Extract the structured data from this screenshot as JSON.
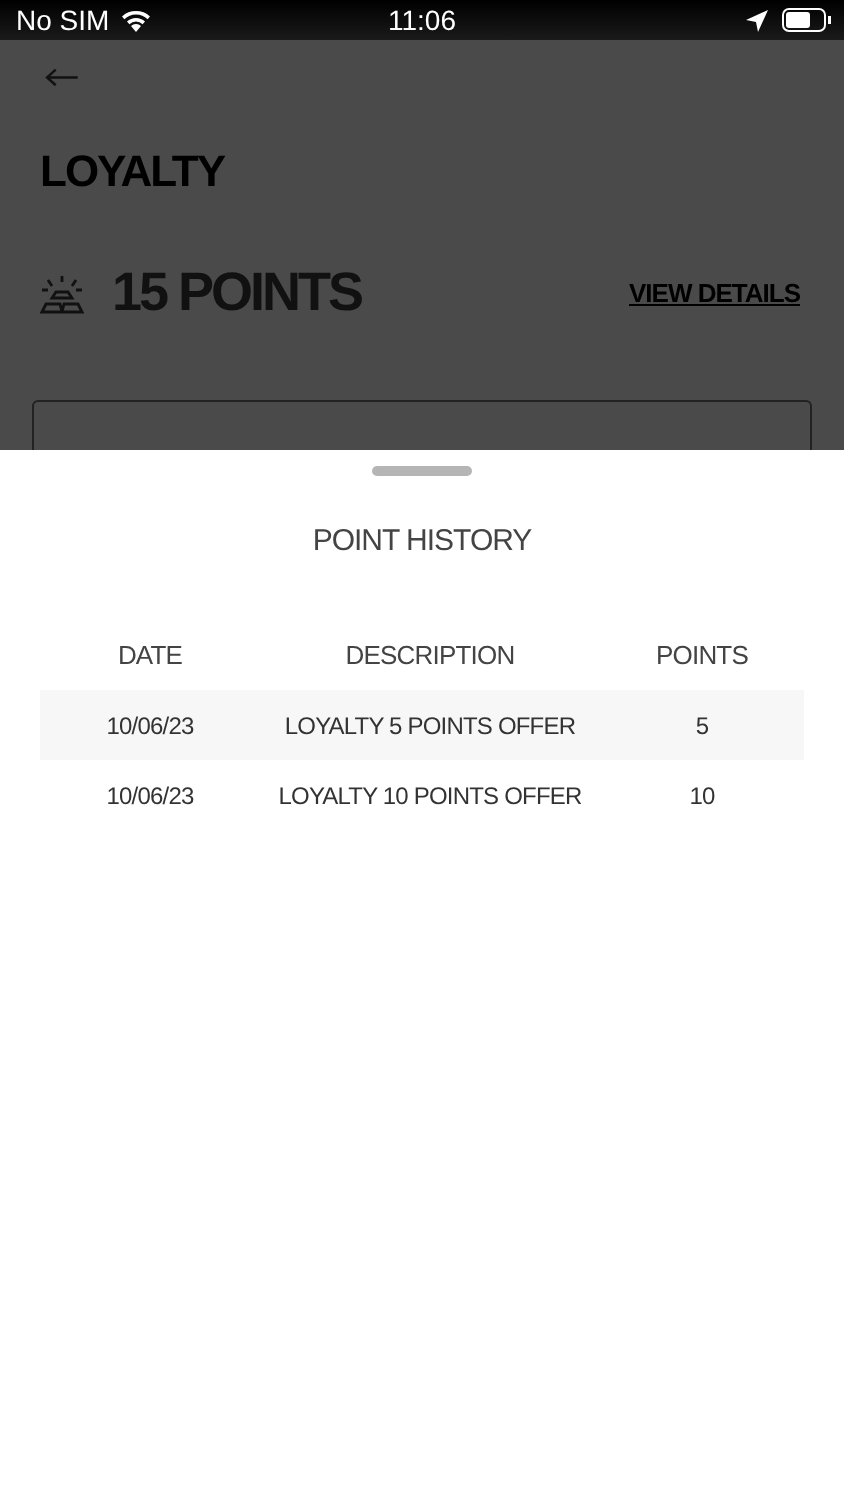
{
  "status_bar": {
    "carrier": "No SIM",
    "time": "11:06"
  },
  "page": {
    "title": "LOYALTY",
    "points": "15 POINTS",
    "details_link": "VIEW DETAILS"
  },
  "sheet": {
    "title": "POINT HISTORY",
    "table": {
      "columns": [
        "DATE",
        "DESCRIPTION",
        "POINTS"
      ],
      "rows": [
        {
          "cells": [
            "10/06/23",
            "LOYALTY 5  POINTS OFFER",
            "5"
          ]
        },
        {
          "cells": [
            "10/06/23",
            "LOYALTY 10 POINTS OFFER",
            "10"
          ]
        }
      ]
    }
  }
}
